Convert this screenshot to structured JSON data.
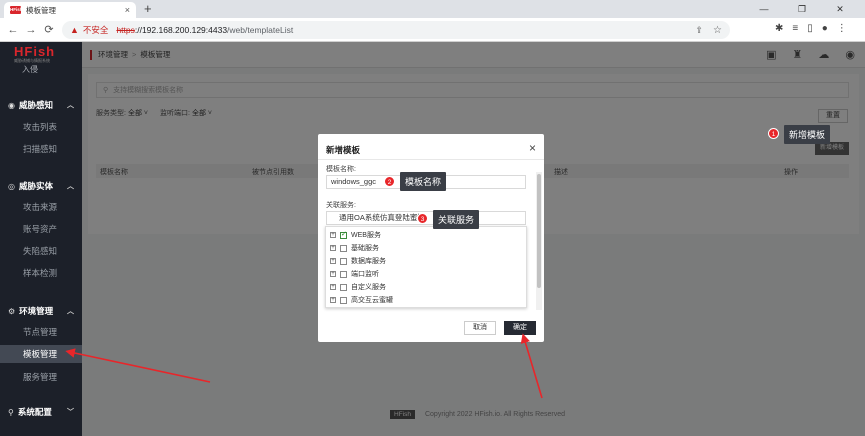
{
  "browser": {
    "tab_title": "模板管理",
    "favicon_text": "HFish",
    "tab_close": "×",
    "new_tab": "+",
    "win_min": "—",
    "win_restore": "❐",
    "win_close": "✕",
    "security_label": "不安全",
    "url_protocol": "https",
    "url_host": "://192.168.200.129:4433",
    "url_path": "/web/templateList"
  },
  "app": {
    "logo": "HFish",
    "logo_sub": "威胁诱捕与情报系统",
    "cut_item": "入侵"
  },
  "sidebar": {
    "groups": [
      {
        "label": "威胁感知",
        "items": [
          "攻击列表",
          "扫描感知"
        ]
      },
      {
        "label": "威胁实体",
        "items": [
          "攻击来源",
          "账号资产",
          "失陷感知",
          "样本检测"
        ]
      },
      {
        "label": "环境管理",
        "items": [
          "节点管理",
          "模板管理",
          "服务管理"
        ]
      },
      {
        "label": "系统配置",
        "items": []
      }
    ]
  },
  "header": {
    "crumb_root": "环境管理",
    "crumb_sep": ">",
    "crumb_current": "模板管理"
  },
  "main": {
    "search_placeholder": "支持模糊搜索模板名称",
    "filter_service_label": "服务类型:",
    "filter_service_value": "全部",
    "filter_port_label": "监听端口:",
    "filter_port_value": "全部",
    "reset_label": "重置",
    "add_label": "新增模板",
    "columns": [
      "模板名称",
      "被节点引用数",
      "描述",
      "操作"
    ],
    "footer_logo": "HFish",
    "footer_text": "Copyright 2022 HFish.io. All Rights Reserved"
  },
  "modal": {
    "title": "新增模板",
    "close": "×",
    "name_label": "模板名称:",
    "name_value": "windows_ggc",
    "service_label": "关联服务:",
    "service_value": "通用OA系统仿真登陆蜜罐",
    "tree": [
      {
        "label": "WEB服务",
        "checked": true
      },
      {
        "label": "基础服务",
        "checked": false
      },
      {
        "label": "数据库服务",
        "checked": false
      },
      {
        "label": "端口监听",
        "checked": false
      },
      {
        "label": "自定义服务",
        "checked": false
      },
      {
        "label": "高交互云蜜罐",
        "checked": false
      }
    ],
    "cancel_label": "取消",
    "ok_label": "确定"
  },
  "annotations": [
    {
      "num": "1",
      "text": "新增模板"
    },
    {
      "num": "2",
      "text": "模板名称"
    },
    {
      "num": "3",
      "text": "关联服务"
    }
  ],
  "colors": {
    "brand_red": "#d9262c",
    "sidebar_bg": "#1c2029",
    "annotation_red": "#e8262a"
  }
}
